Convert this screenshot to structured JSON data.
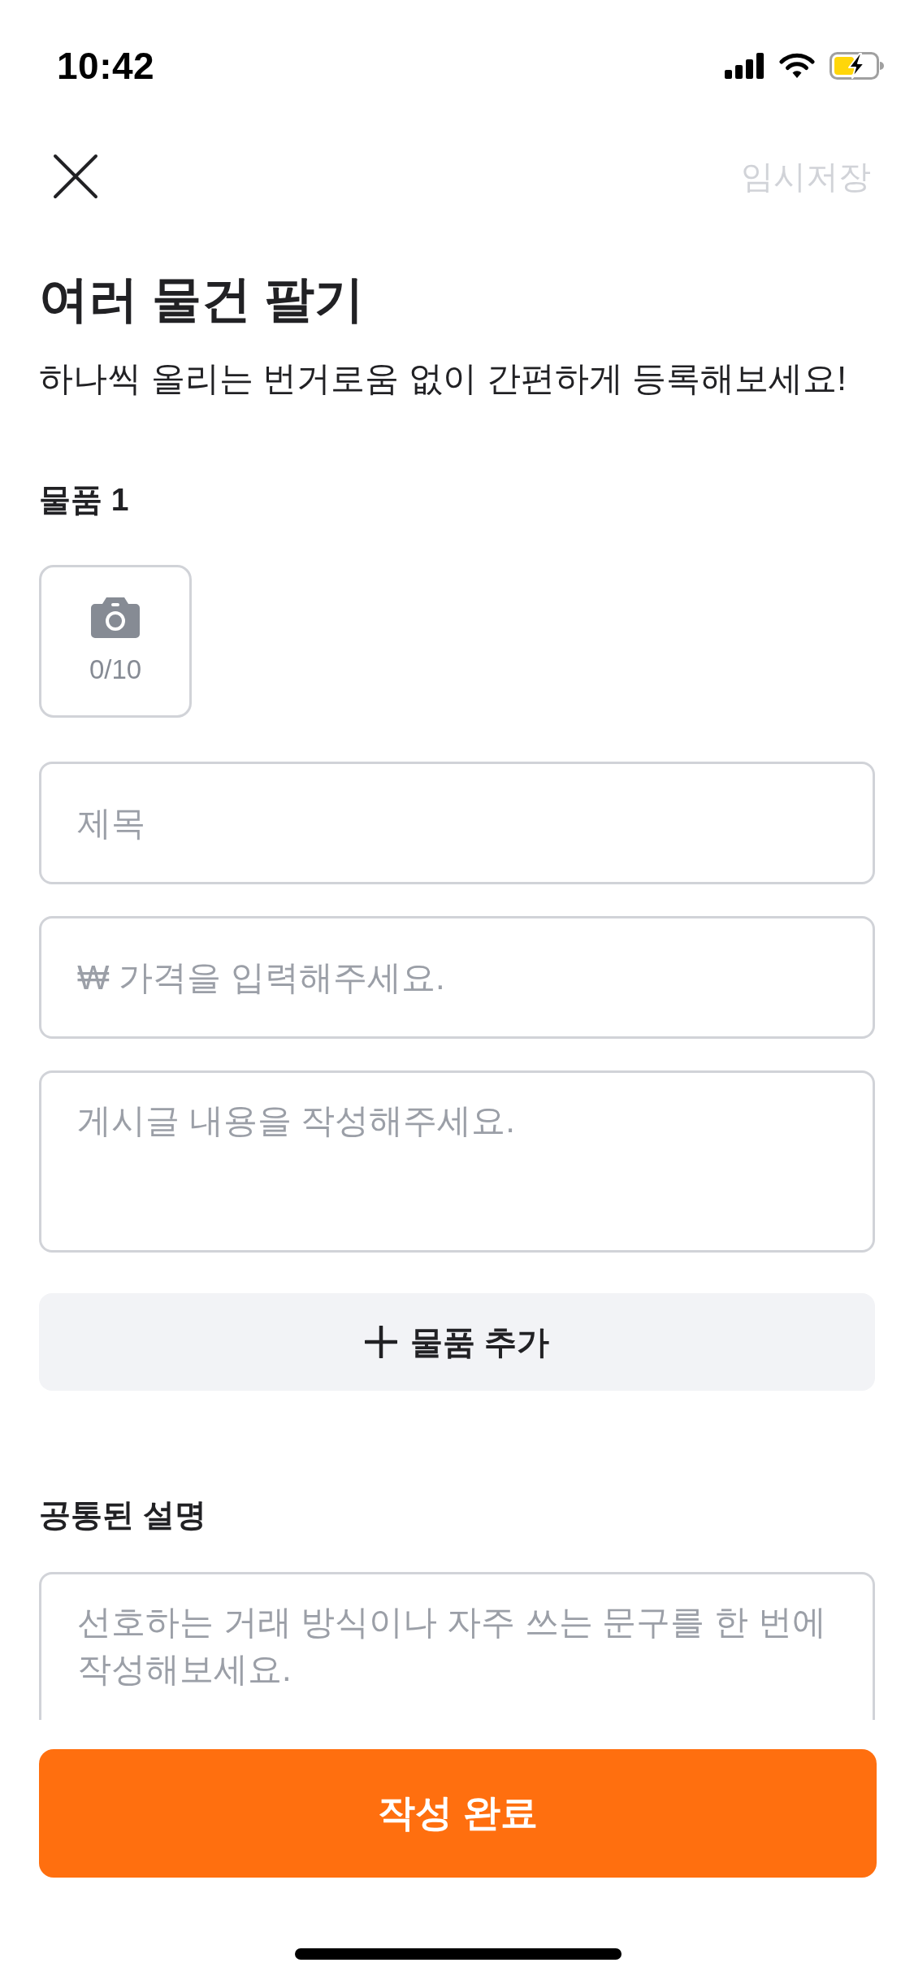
{
  "status_bar": {
    "time": "10:42"
  },
  "header": {
    "save_button": {
      "label": "임시저장",
      "disabled": true
    }
  },
  "title": "여러 물건 팔기",
  "subtitle": "하나씩 올리는 번거로움 없이 간편하게 등록해보세요!",
  "items": [
    {
      "heading": "물품 1",
      "photo_count": "0/10",
      "fields": [
        {
          "kind": "input",
          "placeholder": "제목"
        },
        {
          "kind": "input",
          "placeholder": "₩ 가격을 입력해주세요."
        },
        {
          "kind": "textarea",
          "placeholder": "게시글 내용을 작성해주세요."
        }
      ]
    }
  ],
  "add_item_button": {
    "label": "물품 추가"
  },
  "shared_description": {
    "heading": "공통된 설명",
    "placeholder": "선호하는 거래 방식이나 자주 쓰는 문구를 한 번에 작성해보세요."
  },
  "submit_button": {
    "label": "작성 완료"
  }
}
